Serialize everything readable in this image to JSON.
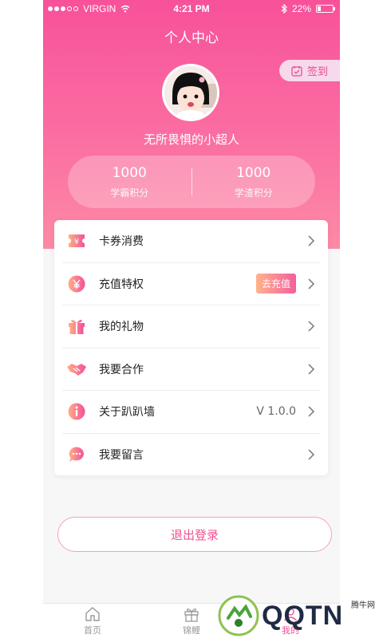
{
  "status_bar": {
    "carrier": "VIRGIN",
    "time": "4:21 PM",
    "battery": "22%"
  },
  "header": {
    "title": "个人中心",
    "checkin_label": "签到"
  },
  "profile": {
    "username": "无所畏惧的小超人"
  },
  "stats": [
    {
      "value": "1000",
      "label": "学霸积分"
    },
    {
      "value": "1000",
      "label": "学渣积分"
    }
  ],
  "menu": [
    {
      "label": "卡券消费",
      "icon": "ticket-icon"
    },
    {
      "label": "充值特权",
      "icon": "yuan-icon",
      "action": "去充值"
    },
    {
      "label": "我的礼物",
      "icon": "gift-icon"
    },
    {
      "label": "我要合作",
      "icon": "handshake-icon"
    },
    {
      "label": "关于趴趴墙",
      "icon": "info-icon",
      "value": "V 1.0.0"
    },
    {
      "label": "我要留言",
      "icon": "message-icon"
    }
  ],
  "logout_label": "退出登录",
  "tabs": [
    {
      "label": "首页",
      "icon": "home-icon"
    },
    {
      "label": "锦鲤",
      "icon": "gift-icon"
    },
    {
      "label": "我的",
      "icon": "profile-icon"
    }
  ],
  "watermark": {
    "text": "QQTN",
    "sub": "腾牛网"
  },
  "colors": {
    "accent": "#f24f93",
    "gradient_top": "#f7519a",
    "gradient_bottom": "#fc8aa5"
  }
}
